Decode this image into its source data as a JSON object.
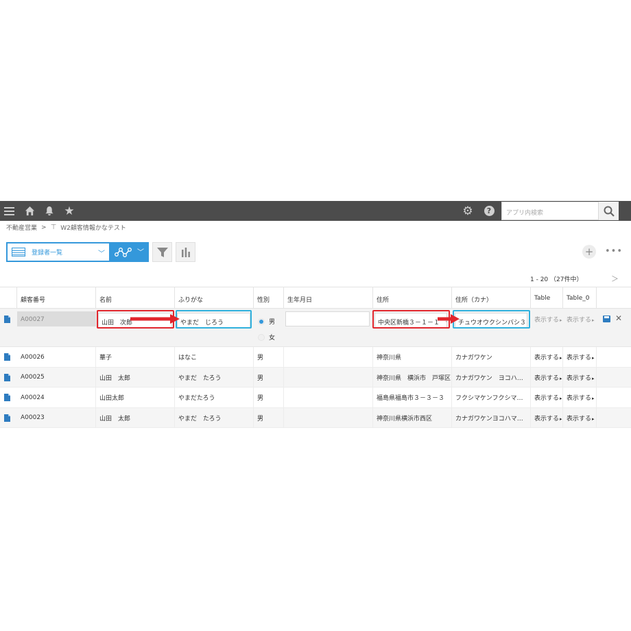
{
  "header": {
    "icons": [
      "menu-icon",
      "home-icon",
      "bell-icon",
      "star-icon",
      "gear-icon",
      "help-icon",
      "search-icon"
    ],
    "search_placeholder": "アプリ内検索"
  },
  "breadcrumb": {
    "space": "不動産営業",
    "separator": ">",
    "app": "W2顧客情報かなテスト"
  },
  "toolbar": {
    "view_label": "登録者一覧"
  },
  "pagination": {
    "label": "1 - 20 （27件中）"
  },
  "table": {
    "columns": [
      "顧客番号",
      "名前",
      "ふりがな",
      "性別",
      "生年月日",
      "住所",
      "住所（カナ）",
      "Table",
      "Table_0"
    ],
    "edit_row": {
      "id": "A00027",
      "name": "山田　次郎",
      "furigana": "やまだ　じろう",
      "gender_options": [
        "男",
        "女"
      ],
      "gender_selected": "男",
      "birthday": "",
      "address": "中央区新橋３－１－１　仕",
      "address_kana": "チュウオウクシンバシ３－",
      "table": "表示する",
      "table0": "表示する"
    },
    "rows": [
      {
        "id": "A00026",
        "name": "華子",
        "furigana": "はなこ",
        "gender": "男",
        "birthday": "",
        "address": "神奈川県",
        "address_kana": "カナガワケン",
        "table": "表示する",
        "table0": "表示する"
      },
      {
        "id": "A00025",
        "name": "山田　太郎",
        "furigana": "やまだ　たろう",
        "gender": "男",
        "birthday": "",
        "address": "神奈川県　横浜市　戸塚区",
        "address_kana": "カナガワケン　ヨコハ…",
        "table": "表示する",
        "table0": "表示する"
      },
      {
        "id": "A00024",
        "name": "山田太郎",
        "furigana": "やまだたろう",
        "gender": "男",
        "birthday": "",
        "address": "福島県福島市３－３－３",
        "address_kana": "フクシマケンフクシマ…",
        "table": "表示する",
        "table0": "表示する"
      },
      {
        "id": "A00023",
        "name": "山田　太郎",
        "furigana": "やまだ　たろう",
        "gender": "男",
        "birthday": "",
        "address": "神奈川県横浜市西区",
        "address_kana": "カナガワケンヨコハマ…",
        "table": "表示する",
        "table0": "表示する"
      }
    ]
  },
  "colors": {
    "topbar": "#4c4c4c",
    "accent_blue": "#3498db",
    "highlight_red": "#e1262d",
    "highlight_blue": "#2fb0dd",
    "row_stripe": "#f5f5f5"
  }
}
